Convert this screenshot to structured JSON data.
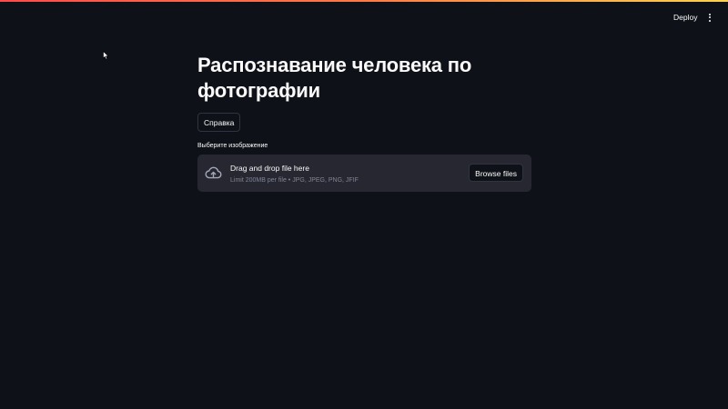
{
  "header": {
    "deploy_label": "Deploy",
    "menu_icon": "more-vertical-icon"
  },
  "colors": {
    "background": "#0e1117",
    "surface": "#262730",
    "text": "#fafafa",
    "muted": "#808495",
    "accent_gradient": [
      "#ff4b4b",
      "#ff7a45",
      "#ffd24d"
    ]
  },
  "main": {
    "title": "Распознавание человека по фотографии",
    "help_button": "Справка",
    "uploader": {
      "label": "Выберите изображение",
      "drop_text": "Drag and drop file here",
      "limit_text": "Limit 200MB per file • JPG, JPEG, PNG, JFIF",
      "browse_label": "Browse files",
      "icon": "cloud-upload-icon"
    }
  }
}
